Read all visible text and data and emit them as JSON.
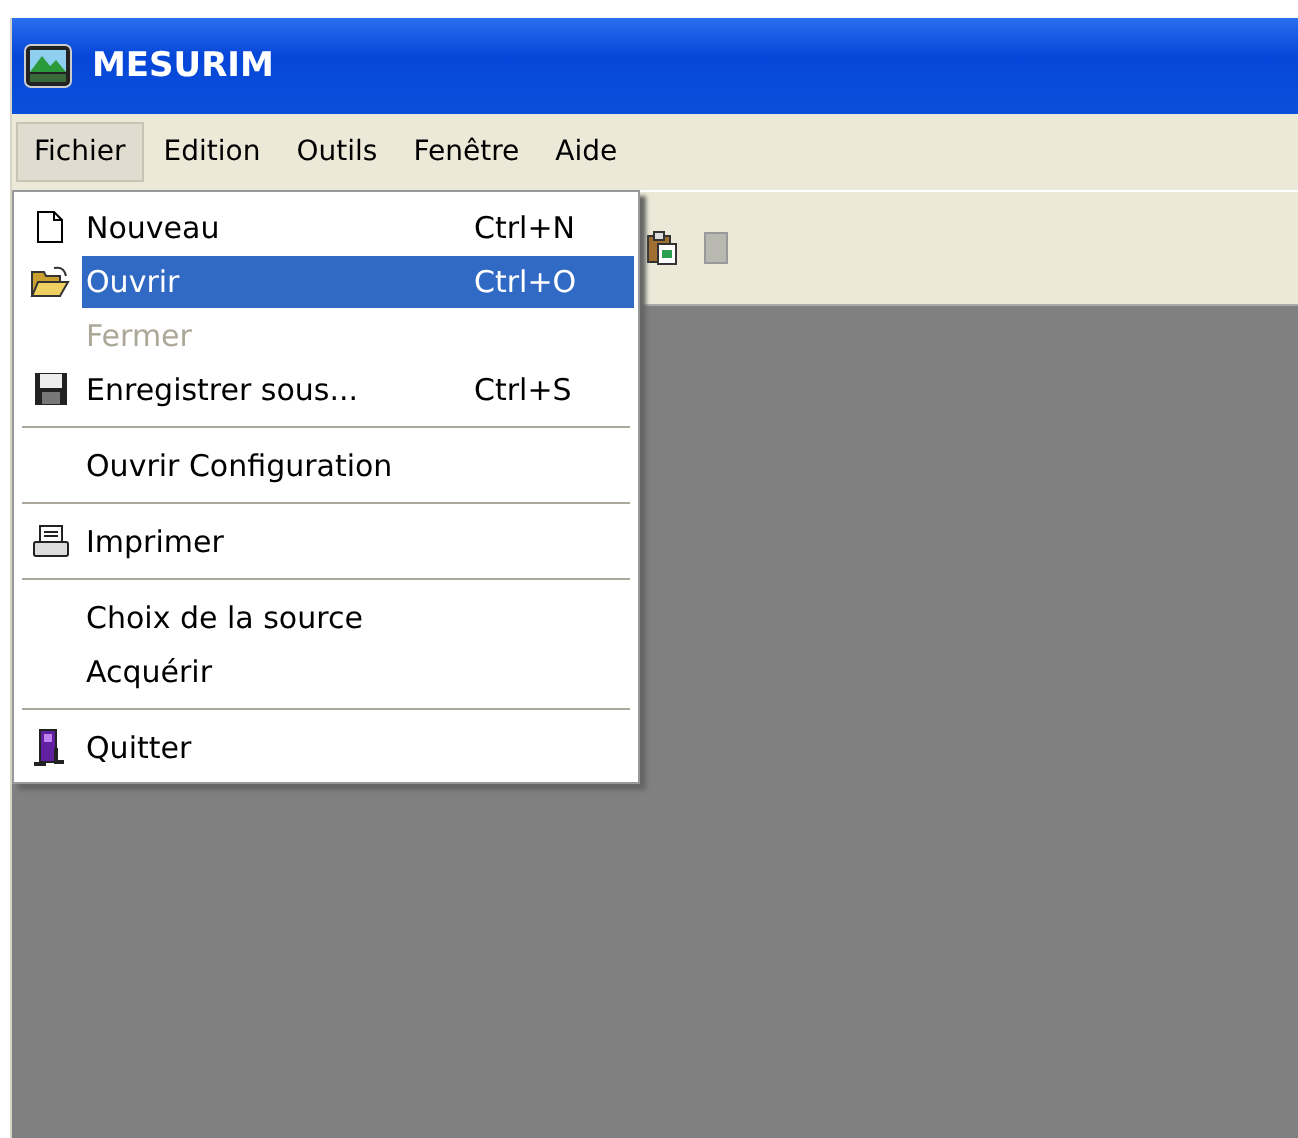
{
  "window": {
    "title": "MESURIM"
  },
  "menubar": [
    {
      "label": "Fichier",
      "selected": true
    },
    {
      "label": "Edition",
      "selected": false
    },
    {
      "label": "Outils",
      "selected": false
    },
    {
      "label": "Fenêtre",
      "selected": false
    },
    {
      "label": "Aide",
      "selected": false
    }
  ],
  "menu": [
    {
      "kind": "item",
      "label": "Nouveau",
      "shortcut": "Ctrl+N",
      "selected": false,
      "disabled": false
    },
    {
      "kind": "item",
      "label": "Ouvrir",
      "shortcut": "Ctrl+O",
      "selected": true,
      "disabled": false
    },
    {
      "kind": "item",
      "label": "Fermer",
      "selected": false,
      "disabled": true
    },
    {
      "kind": "item",
      "label": "Enregistrer sous...",
      "shortcut": "Ctrl+S",
      "selected": false,
      "disabled": false
    },
    {
      "kind": "separator"
    },
    {
      "kind": "item",
      "label": "Ouvrir Configuration",
      "selected": false,
      "disabled": false
    },
    {
      "kind": "separator"
    },
    {
      "kind": "item",
      "label": "Imprimer",
      "selected": false,
      "disabled": false
    },
    {
      "kind": "separator"
    },
    {
      "kind": "item",
      "label": "Choix de la source",
      "selected": false,
      "disabled": false
    },
    {
      "kind": "item",
      "label": "Acquérir",
      "selected": false,
      "disabled": false
    },
    {
      "kind": "separator"
    },
    {
      "kind": "item",
      "label": "Quitter",
      "selected": false,
      "disabled": false
    }
  ]
}
